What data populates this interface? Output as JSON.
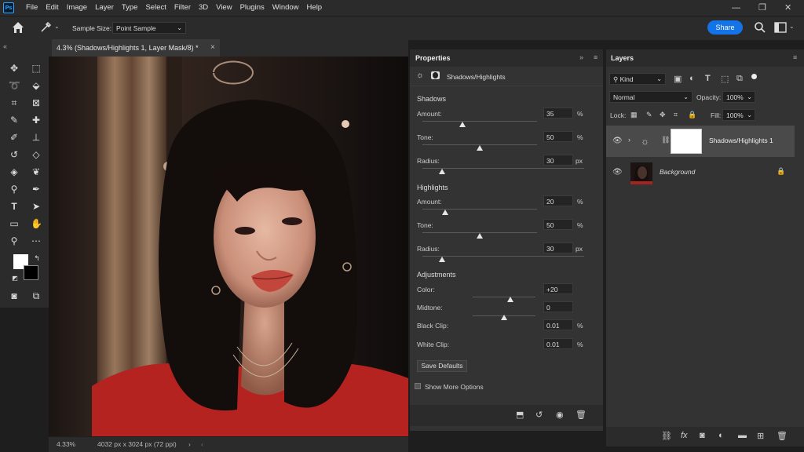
{
  "app": {
    "logo": "Ps"
  },
  "menu": [
    "File",
    "Edit",
    "Image",
    "Layer",
    "Type",
    "Select",
    "Filter",
    "3D",
    "View",
    "Plugins",
    "Window",
    "Help"
  ],
  "options_bar": {
    "sample_size_label": "Sample Size:",
    "sample_size_value": "Point Sample",
    "share_label": "Share"
  },
  "document": {
    "tab_title": "4.3% (Shadows/Highlights 1, Layer Mask/8) *",
    "close_glyph": "×"
  },
  "status_bar": {
    "zoom": "4.33%",
    "dimensions": "4032 px x 3024 px (72 ppi)"
  },
  "properties": {
    "tab_label": "Properties",
    "adjustment_name": "Shadows/Highlights",
    "shadows": {
      "title": "Shadows",
      "amount": {
        "label": "Amount:",
        "value": "35",
        "unit": "%",
        "fraction": 0.35
      },
      "tone": {
        "label": "Tone:",
        "value": "50",
        "unit": "%",
        "fraction": 0.5
      },
      "radius": {
        "label": "Radius:",
        "value": "30",
        "unit": "px",
        "fraction": 0.12
      }
    },
    "highlights": {
      "title": "Highlights",
      "amount": {
        "label": "Amount:",
        "value": "20",
        "unit": "%",
        "fraction": 0.2
      },
      "tone": {
        "label": "Tone:",
        "value": "50",
        "unit": "%",
        "fraction": 0.5
      },
      "radius": {
        "label": "Radius:",
        "value": "30",
        "unit": "px",
        "fraction": 0.12
      }
    },
    "adjustments": {
      "title": "Adjustments",
      "color": {
        "label": "Color:",
        "value": "+20",
        "fraction": 0.6
      },
      "midtone": {
        "label": "Midtone:",
        "value": "0",
        "fraction": 0.5
      },
      "black_clip": {
        "label": "Black Clip:",
        "value": "0.01",
        "unit": "%"
      },
      "white_clip": {
        "label": "White Clip:",
        "value": "0.01",
        "unit": "%"
      }
    },
    "save_defaults_label": "Save Defaults",
    "show_more_options_label": "Show More Options"
  },
  "layers": {
    "tab_label": "Layers",
    "filter_kind": "Kind",
    "blend_mode": "Normal",
    "opacity_label": "Opacity:",
    "opacity_value": "100%",
    "lock_label": "Lock:",
    "fill_label": "Fill:",
    "fill_value": "100%",
    "items": [
      {
        "name": "Shadows/Highlights 1"
      },
      {
        "name": "Background"
      }
    ]
  },
  "colors": {
    "accent": "#1473e6",
    "panel": "#333333",
    "chrome": "#2b2b2b"
  }
}
